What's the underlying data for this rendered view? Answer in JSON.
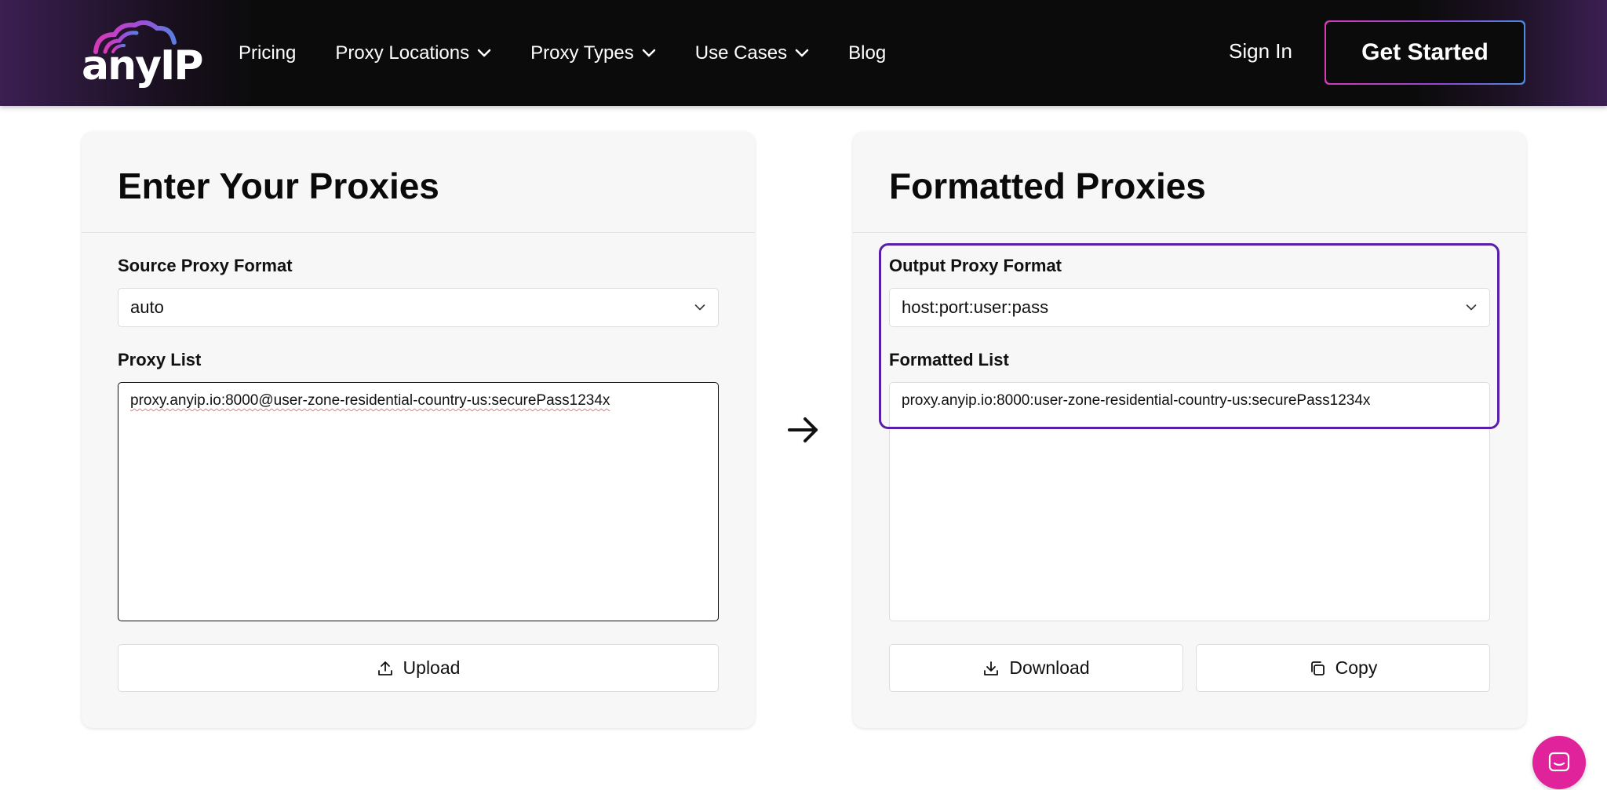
{
  "header": {
    "logo_text": "anyIP",
    "nav": [
      {
        "label": "Pricing",
        "has_dropdown": false
      },
      {
        "label": "Proxy Locations",
        "has_dropdown": true
      },
      {
        "label": "Proxy Types",
        "has_dropdown": true
      },
      {
        "label": "Use Cases",
        "has_dropdown": true
      },
      {
        "label": "Blog",
        "has_dropdown": false
      }
    ],
    "sign_in": "Sign In",
    "get_started": "Get Started"
  },
  "input_card": {
    "title": "Enter Your Proxies",
    "source_format_label": "Source Proxy Format",
    "source_format_value": "auto",
    "proxy_list_label": "Proxy List",
    "proxy_list_value": "proxy.anyip.io:8000@user-zone-residential-country-us:securePass1234x",
    "upload_label": "Upload"
  },
  "output_card": {
    "title": "Formatted Proxies",
    "output_format_label": "Output Proxy Format",
    "output_format_value": "host:port:user:pass",
    "formatted_list_label": "Formatted List",
    "formatted_list_value": "proxy.anyip.io:8000:user-zone-residential-country-us:securePass1234x",
    "download_label": "Download",
    "copy_label": "Copy"
  },
  "colors": {
    "brand_pink": "#e0239a",
    "highlight_purple": "#5a1fa8",
    "header_bg": "#0b0b0b"
  },
  "icons": {
    "arrow": "arrow-right-icon",
    "upload": "upload-icon",
    "download": "download-icon",
    "copy": "copy-icon",
    "chat": "chat-icon"
  }
}
